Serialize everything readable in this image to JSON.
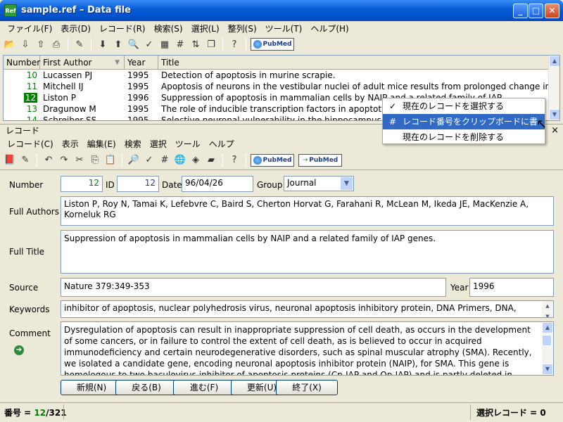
{
  "window": {
    "title": "sample.ref – Data file",
    "icon_text": "Ref"
  },
  "menu": [
    "ファイル(F)",
    "表示(D)",
    "レコード(R)",
    "検索(S)",
    "選択(L)",
    "整列(S)",
    "ツール(T)",
    "ヘルプ(H)"
  ],
  "list": {
    "columns": [
      "Number",
      "First Author",
      "Year",
      "Title"
    ],
    "rows": [
      {
        "number": "10",
        "author": "Lucassen PJ",
        "year": "1995",
        "title": "Detection of apoptosis in murine scrapie."
      },
      {
        "number": "11",
        "author": "Mitchell IJ",
        "year": "1995",
        "title": "Apoptosis of neurons in the vestibular nuclei of adult mice results from prolonged change in t.."
      },
      {
        "number": "12",
        "author": "Liston P",
        "year": "1996",
        "title": "Suppression of apoptosis in mammalian cells by NAIP and a related family of IAP"
      },
      {
        "number": "13",
        "author": "Dragunow M",
        "year": "1995",
        "title": "The role of inducible transcription factors in apoptotic n"
      },
      {
        "number": "14",
        "author": "Schreiber SS",
        "year": "1995",
        "title": "Selective neuronal vulnerability in the hippocampus"
      }
    ]
  },
  "context_menu": [
    "現在のレコードを選択する",
    "レコード番号をクリップボードに書き込む",
    "現在のレコードを削除する"
  ],
  "panel": {
    "title": "レコード",
    "close": "×"
  },
  "record_menu": [
    "レコード(C)",
    "表示",
    "編集(E)",
    "検索",
    "選択",
    "ツール",
    "ヘルプ"
  ],
  "pubmed": "PubMed",
  "record": {
    "labels": {
      "number": "Number",
      "id": "ID",
      "date": "Date",
      "group": "Group",
      "full_authors": "Full Authors",
      "full_title": "Full Title",
      "source": "Source",
      "year": "Year",
      "keywords": "Keywords",
      "comment": "Comment"
    },
    "number": "12",
    "id": "12",
    "date": "96/04/26",
    "group": "Journal",
    "authors": "Liston P, Roy N, Tamai K, Lefebvre C, Baird S, Cherton Horvat G, Farahani R, McLean M, Ikeda JE, MacKenzie A, Korneluk RG",
    "title": "Suppression of apoptosis in mammalian cells by NAIP and a related family of IAP genes.",
    "source": "Nature 379:349-353",
    "year": "1996",
    "keywords": "inhibitor of apoptosis, nuclear polyhedrosis virus, neuronal apoptosis inhibitory protein, DNA Primers, DNA,",
    "comment": "Dysregulation of apoptosis can result in inappropriate suppression of cell death, as occurs in the development of some cancers, or in failure to control the extent of cell death, as is believed to occur in acquired immunodeficiency and certain neurodegenerative disorders, such as spinal muscular atrophy (SMA). Recently, we isolated a candidate gene, encoding neuronal apoptosis inhibitor protein (NAIP), for SMA. This gene is homologous to two baculovirus inhibitor of apoptosis proteins (Cp-IAP and Op-IAP) and is partly deleted in individuals with type I SMA. A second"
  },
  "buttons": {
    "new": "新規(N)",
    "back": "戻る(B)",
    "forward": "進む(F)",
    "update": "更新(U)",
    "exit": "終了(X)"
  },
  "status": {
    "left_label": "番号 = ",
    "current": "12",
    "total": "/321",
    "right": "選択レコード = 0"
  },
  "colors": {
    "number_green": "#008000",
    "selection": "#316AC5"
  }
}
